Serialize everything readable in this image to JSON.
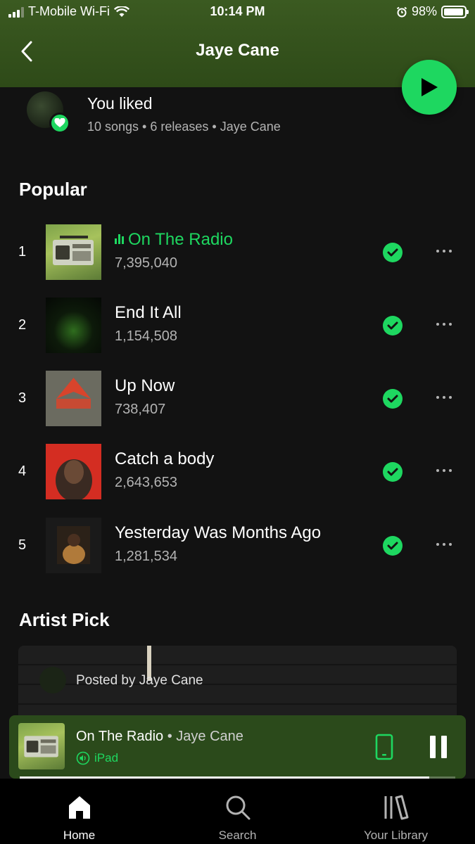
{
  "status_bar": {
    "carrier": "T-Mobile Wi-Fi",
    "time": "10:14 PM",
    "battery": "98%",
    "battery_level": 0.98
  },
  "header": {
    "title": "Jaye Cane",
    "back_icon": "chevron-left-icon"
  },
  "play_button": {
    "icon": "play-icon",
    "color": "#1ed760"
  },
  "liked": {
    "title": "You liked",
    "subtitle": "10 songs • 6 releases • Jaye Cane"
  },
  "popular": {
    "title": "Popular",
    "tracks": [
      {
        "rank": "1",
        "title": "On The Radio",
        "plays": "7,395,040",
        "playing": true
      },
      {
        "rank": "2",
        "title": "End It All",
        "plays": "1,154,508",
        "playing": false
      },
      {
        "rank": "3",
        "title": "Up Now",
        "plays": "738,407",
        "playing": false
      },
      {
        "rank": "4",
        "title": "Catch a body",
        "plays": "2,643,653",
        "playing": false
      },
      {
        "rank": "5",
        "title": "Yesterday Was Months Ago",
        "plays": "1,281,534",
        "playing": false
      }
    ]
  },
  "artist_pick": {
    "title": "Artist Pick",
    "posted_by": "Posted by Jaye Cane"
  },
  "mini_player": {
    "title": "On The Radio",
    "separator": " • ",
    "artist": "Jaye Cane",
    "device": "iPad",
    "progress": 0.94
  },
  "tabs": [
    {
      "label": "Home",
      "icon": "home-icon",
      "active": true
    },
    {
      "label": "Search",
      "icon": "search-icon",
      "active": false
    },
    {
      "label": "Your Library",
      "icon": "library-icon",
      "active": false
    }
  ],
  "colors": {
    "accent": "#1ed760",
    "header_bg": "#3b5a21",
    "background": "#121212",
    "mini_player_bg": "#2b4a1b"
  }
}
